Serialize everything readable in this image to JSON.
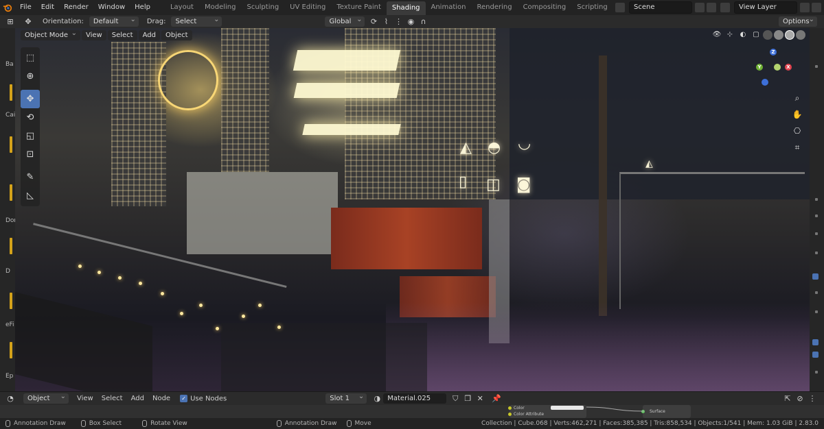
{
  "menu": {
    "file": "File",
    "edit": "Edit",
    "render": "Render",
    "window": "Window",
    "help": "Help"
  },
  "workspaces": [
    "Layout",
    "Modeling",
    "Sculpting",
    "UV Editing",
    "Texture Paint",
    "Shading",
    "Animation",
    "Rendering",
    "Compositing",
    "Scripting"
  ],
  "active_workspace": "Shading",
  "add_workspace": "+",
  "scene": {
    "name": "Scene",
    "view_layer": "View Layer"
  },
  "header2": {
    "orientation_label": "Orientation:",
    "orientation_value": "Default",
    "drag_label": "Drag:",
    "drag_value": "Select Box",
    "transform_value": "Global",
    "options_label": "Options"
  },
  "viewport_header": {
    "mode": "Object Mode",
    "view": "View",
    "select": "Select",
    "add": "Add",
    "object": "Object"
  },
  "left_strip_labels": [
    "Ba",
    "Cai",
    "Dor",
    "D",
    "eFi",
    "Ep"
  ],
  "gizmo": {
    "x": "X",
    "y": "Y",
    "z": "Z"
  },
  "node_header": {
    "editor_type": "Object",
    "view": "View",
    "select": "Select",
    "add": "Add",
    "node": "Node",
    "use_nodes": "Use Nodes",
    "slot": "Slot 1",
    "material": "Material.025"
  },
  "node_canvas": {
    "labels": [
      "Color",
      "Color Attribute",
      "Surface"
    ]
  },
  "statusbar": {
    "left_items": [
      "Annotation Draw",
      "Box Select",
      "Rotate View"
    ],
    "mid_items": [
      "Annotation Draw",
      "Move"
    ],
    "stats": "Collection | Cube.068 | Verts:462,271 | Faces:385,385 | Tris:858,534 | Objects:1/541 | Mem: 1.03 GiB | 2.83.0"
  },
  "colors": {
    "accent": "#4b73b3",
    "top_bar": "#232323",
    "header": "#2b2b2b",
    "neon": "#ffd36a"
  }
}
